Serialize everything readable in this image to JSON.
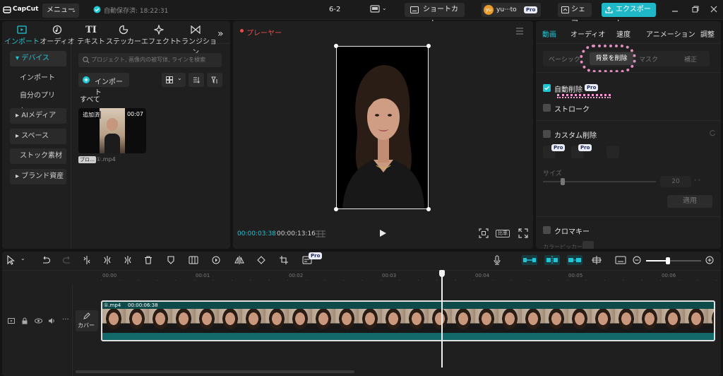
{
  "titlebar": {
    "app_name": "CapCut",
    "menu_label": "メニュー",
    "autosave": "自動保存済: 18:22:31",
    "project_name": "6-2",
    "shortcut_label": "ショートカット",
    "user_avatar": "yu",
    "user_name": "yu···to",
    "pro_badge": "Pro",
    "share_label": "シェア",
    "export_label": "エクスポート",
    "accent_color": "#1fb8c9"
  },
  "media_tabs": [
    {
      "label": "インポート",
      "icon": "import-icon"
    },
    {
      "label": "オーディオ",
      "icon": "audio-icon"
    },
    {
      "label": "テキスト",
      "icon": "text-icon"
    },
    {
      "label": "ステッカー",
      "icon": "sticker-icon"
    },
    {
      "label": "エフェクト",
      "icon": "effects-icon"
    },
    {
      "label": "トランジション",
      "icon": "transition-icon"
    }
  ],
  "sidebar": {
    "items": [
      {
        "label": "デバイス"
      },
      {
        "label": "インポート"
      },
      {
        "label": "自分のプリセ…"
      },
      {
        "label": "AIメディア"
      },
      {
        "label": "スペース"
      },
      {
        "label": "ストック素材"
      },
      {
        "label": "ブランド資産"
      }
    ]
  },
  "media": {
    "search_placeholder": "プロジェクト, 画像内の被写体, ラインを検索",
    "import_label": "インポート",
    "section_all": "すべて",
    "clip": {
      "added": "追加済",
      "duration": "00:07",
      "tag": "ブロ…",
      "filename": "①.mp4"
    }
  },
  "player": {
    "title": "プレーヤー",
    "current_time": "00:00:03:38",
    "total_time": "00:00:13:16",
    "ratio_label": "比率"
  },
  "properties": {
    "tabs": [
      "動画",
      "オーディオ",
      "速度",
      "アニメーション",
      "調整"
    ],
    "subtabs": [
      "ベーシック",
      "背景を削除",
      "マスク",
      "補正"
    ],
    "auto_remove": "自動削除",
    "stroke": "ストローク",
    "custom_remove": "カスタム削除",
    "size_label": "サイズ",
    "size_value": "20",
    "apply_label": "適用",
    "chroma_key": "クロマキー",
    "color_picker": "カラーピッカー",
    "pro": "Pro"
  },
  "timeline": {
    "ruler": [
      "00:00",
      "00:01",
      "00:02",
      "00:03",
      "00:04",
      "00:05",
      "00:06"
    ],
    "cover_label": "カバー",
    "clip_name": "①.mp4",
    "clip_duration": "00:00:06:38",
    "pro": "Pro"
  }
}
